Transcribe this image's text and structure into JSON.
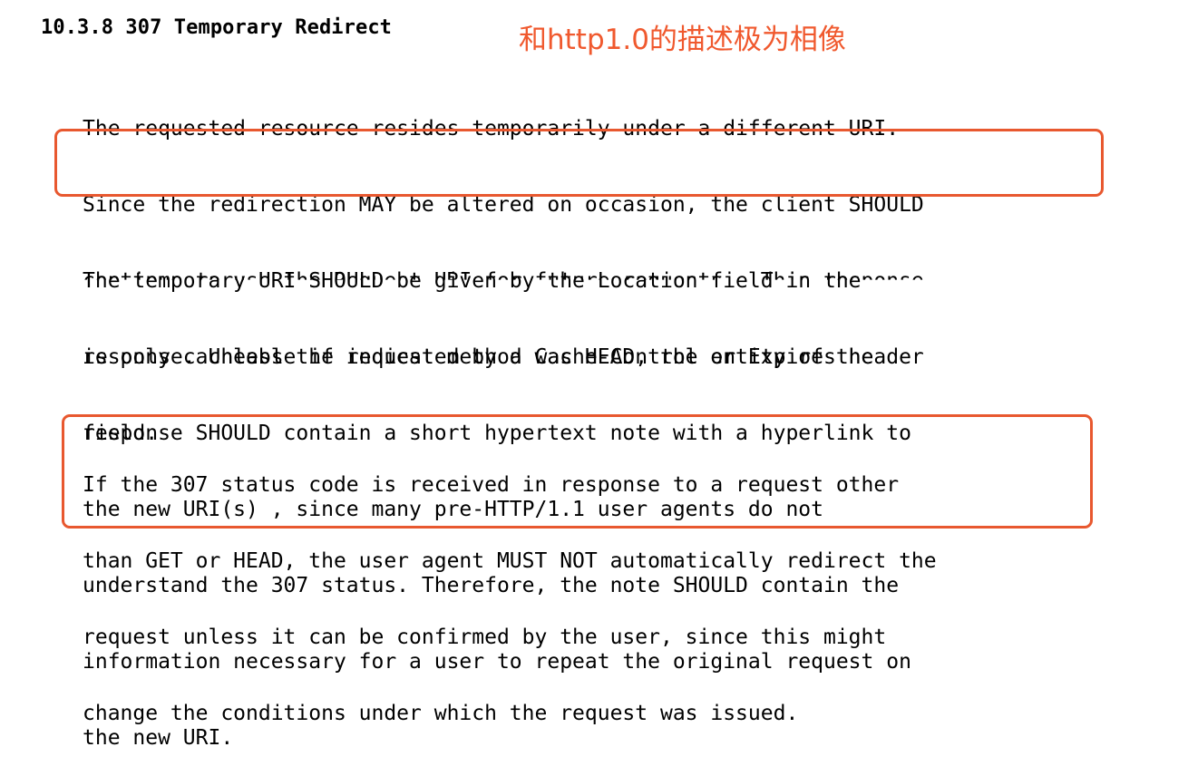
{
  "section": {
    "heading": "10.3.8 307 Temporary Redirect",
    "annotation": "和http1.0的描述极为相像"
  },
  "paragraphs": [
    {
      "lines": [
        "The requested resource resides temporarily under a different URI.",
        "Since the redirection MAY be altered on occasion, the client SHOULD",
        "continue to use the Request-URI for future requests.  This response",
        "is only cacheable if indicated by a Cache-Control or Expires header",
        "field."
      ]
    },
    {
      "lines": [
        "The temporary URI SHOULD be given by the Location field in the",
        "response. Unless the request method was HEAD, the entity of the",
        "response SHOULD contain a short hypertext note with a hyperlink to",
        "the new URI(s) , since many pre-HTTP/1.1 user agents do not",
        "understand the 307 status. Therefore, the note SHOULD contain the",
        "information necessary for a user to repeat the original request on",
        "the new URI."
      ]
    },
    {
      "lines": [
        "If the 307 status code is received in response to a request other",
        "than GET or HEAD, the user agent MUST NOT automatically redirect the",
        "request unless it can be confirmed by the user, since this might",
        "change the conditions under which the request was issued."
      ]
    }
  ],
  "highlight_color": "#e8582f",
  "annotation_color": "#f0592e"
}
